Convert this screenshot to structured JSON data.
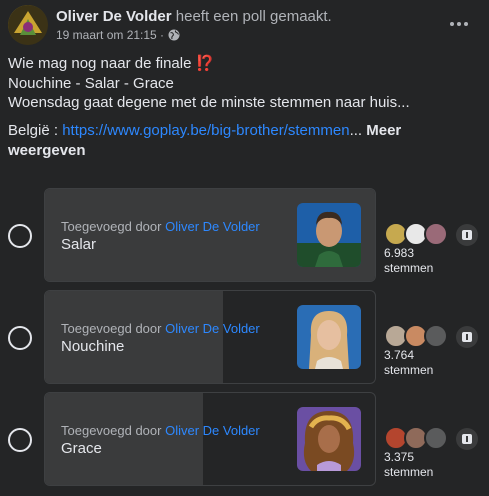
{
  "post": {
    "author": "Oliver De Volder",
    "action": " heeft een poll gemaakt.",
    "timestamp": "19 maart om 21:15 ·",
    "audience_icon": "globe-icon",
    "menu_icon": "more-horizontal-icon",
    "lines": [
      "Wie mag nog naar de finale ⁉️",
      "Nouchine - Salar - Grace",
      "Woensdag gaat degene met de minste stemmen naar huis..."
    ],
    "link_prefix": "België : ",
    "link_text": "https://www.goplay.be/big-brother/stemmen",
    "ellipsis": "...",
    "see_more": "Meer weergeven"
  },
  "poll": {
    "added_by_prefix": "Toegevoegd door ",
    "added_by_name": "Oliver De Volder",
    "options": [
      {
        "name": "Salar",
        "votes": "6.983",
        "votes_label": "stemmen",
        "share": 1.0
      },
      {
        "name": "Nouchine",
        "votes": "3.764",
        "votes_label": "stemmen",
        "share": 0.54
      },
      {
        "name": "Grace",
        "votes": "3.375",
        "votes_label": "stemmen",
        "share": 0.48
      }
    ]
  },
  "colors": {
    "background": "#242526",
    "bar_fill": "#3a3b3c",
    "link": "#2d88ff",
    "text": "#e4e6eb",
    "secondary_text": "#b0b3b8"
  }
}
